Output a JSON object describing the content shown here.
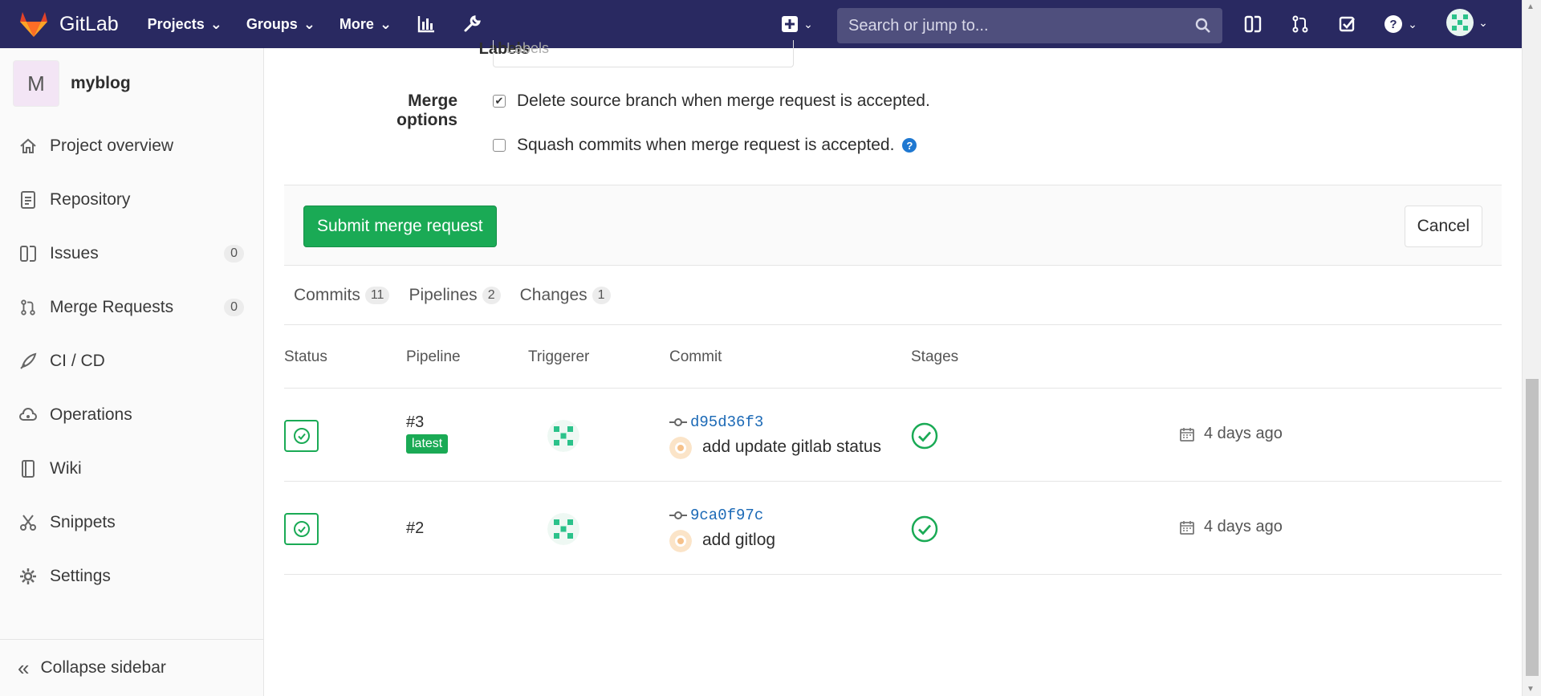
{
  "navbar": {
    "brand": "GitLab",
    "links": [
      "Projects",
      "Groups",
      "More"
    ],
    "search_placeholder": "Search or jump to..."
  },
  "sidebar": {
    "project_initial": "M",
    "project_name": "myblog",
    "items": [
      {
        "label": "Project overview",
        "icon": "home-icon"
      },
      {
        "label": "Repository",
        "icon": "doc-icon"
      },
      {
        "label": "Issues",
        "icon": "issues-icon",
        "count": "0"
      },
      {
        "label": "Merge Requests",
        "icon": "merge-request-icon",
        "count": "0"
      },
      {
        "label": "CI / CD",
        "icon": "rocket-icon"
      },
      {
        "label": "Operations",
        "icon": "cloud-gear-icon"
      },
      {
        "label": "Wiki",
        "icon": "book-icon"
      },
      {
        "label": "Snippets",
        "icon": "scissors-icon"
      },
      {
        "label": "Settings",
        "icon": "gear-icon"
      }
    ],
    "collapse_label": "Collapse sidebar"
  },
  "form": {
    "labels_label": "Labels",
    "labels_placeholder": "Labels",
    "merge_options_label": "Merge options",
    "option_delete": "Delete source branch when merge request is accepted.",
    "option_delete_checked": true,
    "option_squash": "Squash commits when merge request is accepted.",
    "option_squash_checked": false,
    "submit_label": "Submit merge request",
    "cancel_label": "Cancel"
  },
  "tabs": [
    {
      "label": "Commits",
      "count": "11"
    },
    {
      "label": "Pipelines",
      "count": "2"
    },
    {
      "label": "Changes",
      "count": "1"
    }
  ],
  "pipelines": {
    "columns": [
      "Status",
      "Pipeline",
      "Triggerer",
      "Commit",
      "Stages"
    ],
    "rows": [
      {
        "id": "#3",
        "badge": "latest",
        "sha": "d95d36f3",
        "message": "add update gitlab status",
        "time": "4 days ago"
      },
      {
        "id": "#2",
        "badge": "",
        "sha": "9ca0f97c",
        "message": "add gitlog",
        "time": "4 days ago"
      }
    ]
  },
  "colors": {
    "navbar": "#292961",
    "success": "#1aaa55",
    "link": "#1b69b6"
  }
}
